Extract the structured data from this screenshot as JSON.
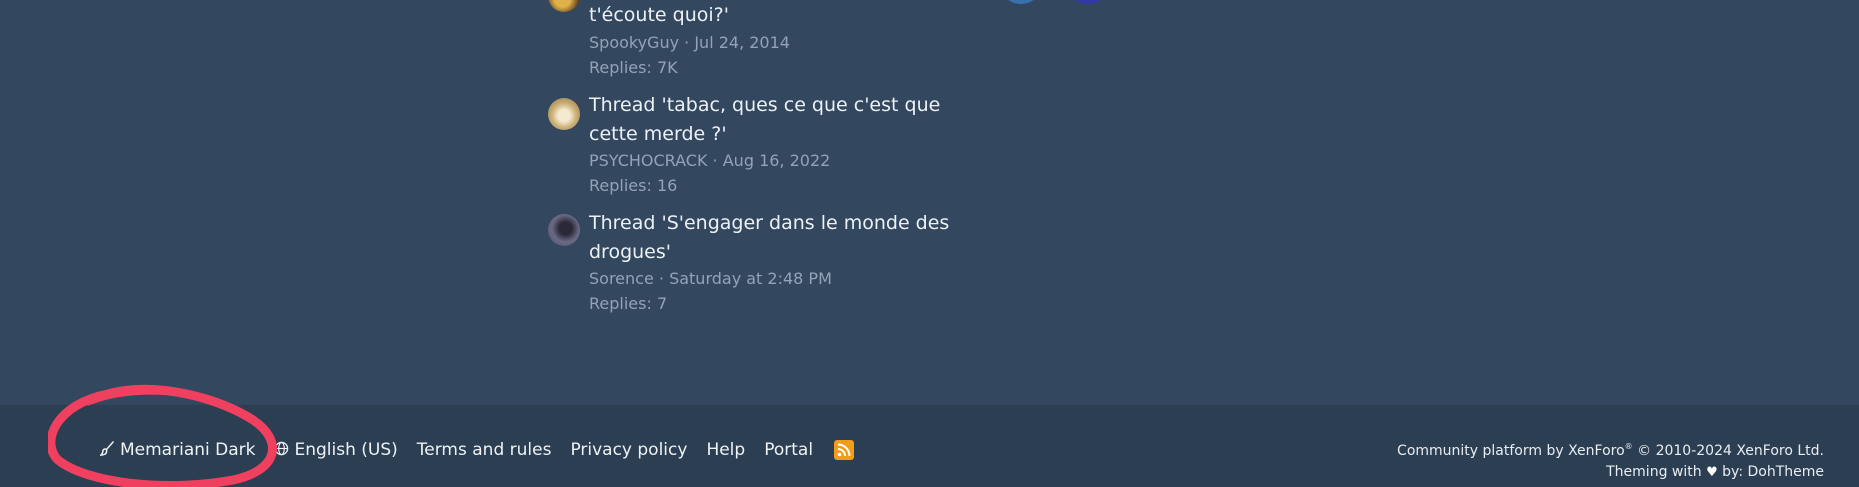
{
  "threads": [
    {
      "title": "t'écoute quoi?'",
      "author": "SpookyGuy",
      "date": "Jul 24, 2014",
      "replies": "Replies: 7K"
    },
    {
      "title": "Thread 'tabac, ques ce que c'est que cette merde ?'",
      "author": "PSYCHOCRACK",
      "date": "Aug 16, 2022",
      "replies": "Replies: 16"
    },
    {
      "title": "Thread 'S'engager dans le monde des drogues'",
      "author": "Sorence",
      "date": "Saturday at 2:48 PM",
      "replies": "Replies: 7"
    }
  ],
  "footer": {
    "style_chooser": "Memariani Dark",
    "language": "English (US)",
    "terms": "Terms and rules",
    "privacy": "Privacy policy",
    "help": "Help",
    "portal": "Portal",
    "rss_icon": "rss-icon",
    "copyright_line1_a": "Community platform by XenForo",
    "copyright_reg": "®",
    "copyright_line1_b": " © 2010-2024 XenForo Ltd.",
    "theming_a": "Theming with ",
    "heart": "♥",
    "theming_b": " by: DohTheme"
  },
  "colors": {
    "background": "#33475e",
    "footer_background": "#2c3e51",
    "annotation": "#f0405f",
    "rss": "#f39c1a",
    "meta_text": "#93a3b6"
  }
}
